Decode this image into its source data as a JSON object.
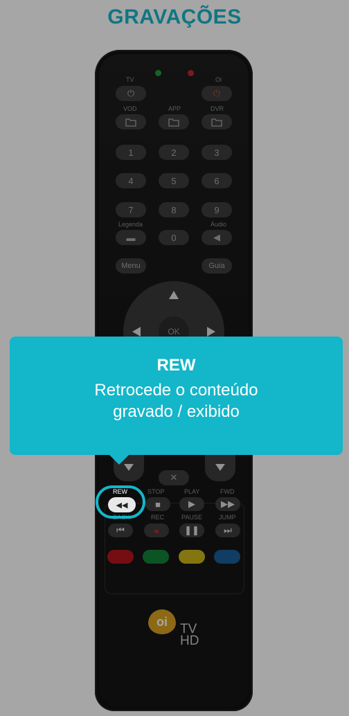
{
  "page": {
    "title": "GRAVAÇÕES"
  },
  "remote": {
    "labels": {
      "tv": "TV",
      "oi": "Oi",
      "vod": "VOD",
      "app": "APP",
      "dvr": "DVR",
      "legenda": "Legenda",
      "audio": "Áudio",
      "rew": "REW",
      "stop": "STOP",
      "play": "PLAY",
      "fwd": "FWD",
      "back": "BACK",
      "rec": "REC",
      "pause": "PAUSE",
      "jump": "JUMP"
    },
    "keys": {
      "k1": "1",
      "k2": "2",
      "k3": "3",
      "k4": "4",
      "k5": "5",
      "k6": "6",
      "k7": "7",
      "k8": "8",
      "k9": "9",
      "k0": "0",
      "menu": "Menu",
      "guia": "Guia",
      "ok": "OK"
    },
    "logo": {
      "oi": "oi",
      "tv": "TV",
      "hd": "HD"
    },
    "colors": {
      "led_green": "#1f9a3a",
      "led_red": "#c0262b",
      "red": "#b3161e",
      "green": "#14813a",
      "yellow": "#c9b51a",
      "blue": "#1a5f95"
    }
  },
  "tooltip": {
    "title": "REW",
    "description_line1": "Retrocede o conteúdo",
    "description_line2": "gravado / exibido",
    "accent": "#14b6c9"
  }
}
